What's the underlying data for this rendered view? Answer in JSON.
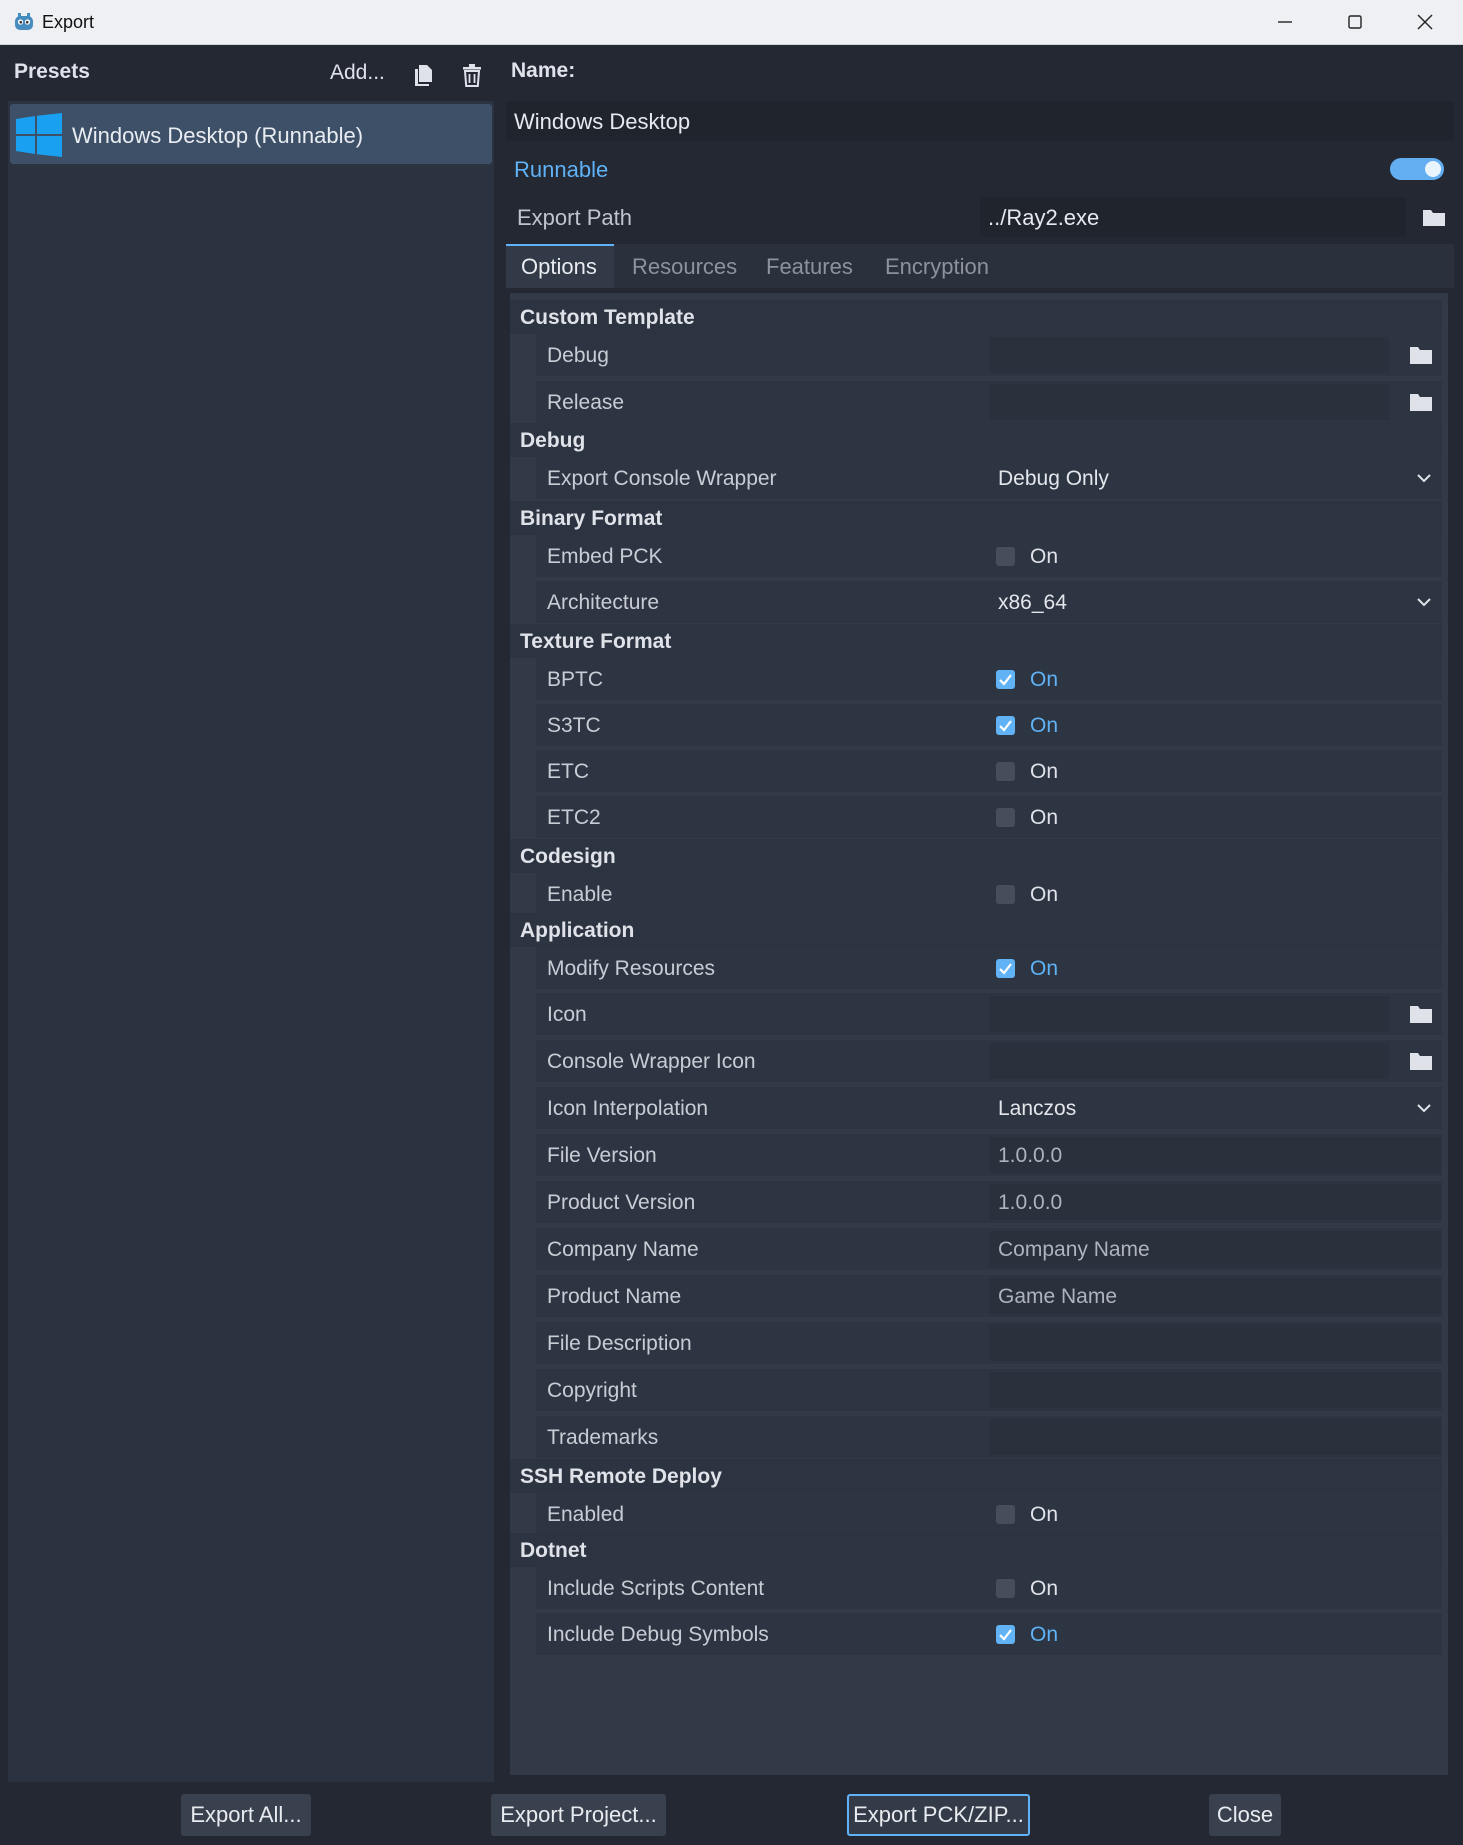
{
  "window": {
    "title": "Export"
  },
  "presets": {
    "title": "Presets",
    "add_label": "Add...",
    "items": [
      {
        "label": "Windows Desktop (Runnable)",
        "selected": true
      }
    ]
  },
  "preset": {
    "name_label": "Name:",
    "name_value": "Windows Desktop",
    "runnable_label": "Runnable",
    "runnable_on": true,
    "export_path_label": "Export Path",
    "export_path_value": "../Ray2.exe"
  },
  "tabs": [
    "Options",
    "Resources",
    "Features",
    "Encryption"
  ],
  "active_tab": "Options",
  "options": {
    "custom_template": {
      "title": "Custom Template",
      "debug_label": "Debug",
      "release_label": "Release"
    },
    "debug": {
      "title": "Debug",
      "export_console_wrapper_label": "Export Console Wrapper",
      "export_console_wrapper_value": "Debug Only"
    },
    "binary_format": {
      "title": "Binary Format",
      "embed_pck_label": "Embed PCK",
      "embed_pck_on": "On",
      "architecture_label": "Architecture",
      "architecture_value": "x86_64"
    },
    "texture_format": {
      "title": "Texture Format",
      "bptc_label": "BPTC",
      "bptc_on": "On",
      "s3tc_label": "S3TC",
      "s3tc_on": "On",
      "etc_label": "ETC",
      "etc_on": "On",
      "etc2_label": "ETC2",
      "etc2_on": "On"
    },
    "codesign": {
      "title": "Codesign",
      "enable_label": "Enable",
      "enable_on": "On"
    },
    "application": {
      "title": "Application",
      "modify_resources_label": "Modify Resources",
      "modify_resources_on": "On",
      "icon_label": "Icon",
      "console_wrapper_icon_label": "Console Wrapper Icon",
      "icon_interpolation_label": "Icon Interpolation",
      "icon_interpolation_value": "Lanczos",
      "file_version_label": "File Version",
      "file_version_placeholder": "1.0.0.0",
      "product_version_label": "Product Version",
      "product_version_placeholder": "1.0.0.0",
      "company_name_label": "Company Name",
      "company_name_placeholder": "Company Name",
      "product_name_label": "Product Name",
      "product_name_placeholder": "Game Name",
      "file_description_label": "File Description",
      "copyright_label": "Copyright",
      "trademarks_label": "Trademarks"
    },
    "ssh_remote_deploy": {
      "title": "SSH Remote Deploy",
      "enabled_label": "Enabled",
      "enabled_on": "On"
    },
    "dotnet": {
      "title": "Dotnet",
      "include_scripts_content_label": "Include Scripts Content",
      "include_scripts_content_on": "On",
      "include_debug_symbols_label": "Include Debug Symbols",
      "include_debug_symbols_on": "On"
    }
  },
  "checkbox_states": {
    "embed_pck": false,
    "bptc": true,
    "s3tc": true,
    "etc": false,
    "etc2": false,
    "codesign_enable": false,
    "modify_resources": true,
    "ssh_enabled": false,
    "include_scripts_content": false,
    "include_debug_symbols": true
  },
  "footer": {
    "export_all": "Export All...",
    "export_project": "Export Project...",
    "export_pck_zip": "Export PCK/ZIP...",
    "close": "Close"
  },
  "colors": {
    "accent": "#5fb2f5",
    "background": "#232833",
    "panel": "#323947"
  },
  "icons": [
    "godot-app-icon",
    "minimize-icon",
    "maximize-icon",
    "close-icon",
    "duplicate-icon",
    "trash-icon",
    "windows-logo-icon",
    "folder-icon",
    "chevron-down-icon",
    "checkmark-icon"
  ]
}
